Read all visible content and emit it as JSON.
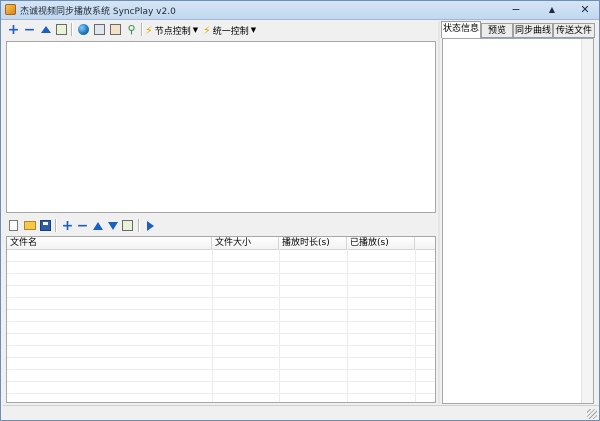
{
  "window": {
    "title": "杰诚视频同步播放系统 SyncPlay v2.0",
    "controls": {
      "minimize": "−",
      "maximize": "▲",
      "close": "✕"
    }
  },
  "toolbar": {
    "node_control": "节点控制",
    "unified_control": "统一控制"
  },
  "tabs": [
    "状态信息",
    "预览",
    "同步曲线",
    "传送文件"
  ],
  "active_tab": "状态信息",
  "file_table": {
    "columns": [
      "文件名",
      "文件大小",
      "播放时长(s)",
      "已播放(s)"
    ],
    "rows": []
  },
  "colors": {
    "accent": "#1a5fc4",
    "titlebar": "#c2d8ef"
  }
}
